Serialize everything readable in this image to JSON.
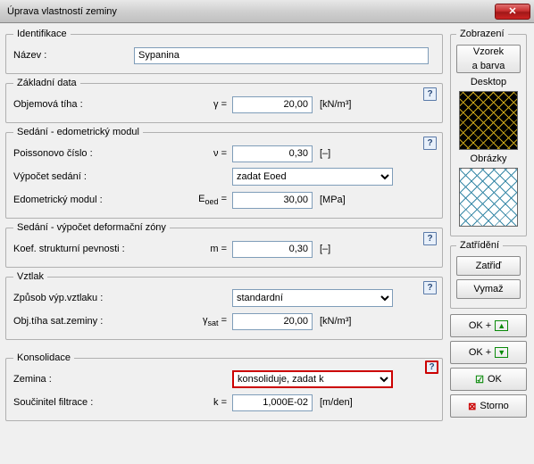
{
  "window": {
    "title": "Úprava vlastností zeminy"
  },
  "ident": {
    "legend": "Identifikace",
    "name_label": "Název :",
    "name_value": "Sypanina"
  },
  "basic": {
    "legend": "Základní data",
    "unit_weight_label": "Objemová tíha :",
    "gamma_sym": "γ =",
    "gamma_value": "20,00",
    "gamma_unit": "[kN/m³]"
  },
  "settlement": {
    "legend": "Sedání - edometrický modul",
    "poisson_label": "Poissonovo číslo :",
    "nu_sym": "ν =",
    "nu_value": "0,30",
    "nu_unit": "[–]",
    "calc_label": "Výpočet sedání :",
    "calc_selected": "zadat Eoed",
    "eoed_label": "Edometrický modul :",
    "eoed_sym": "Eₒₑd =",
    "eoed_value": "30,00",
    "eoed_unit": "[MPa]"
  },
  "defzone": {
    "legend": "Sedání - výpočet deformační zóny",
    "m_label": "Koef. strukturní pevnosti :",
    "m_sym": "m =",
    "m_value": "0,30",
    "m_unit": "[–]"
  },
  "uplift": {
    "legend": "Vztlak",
    "method_label": "Způsob výp.vztlaku :",
    "method_selected": "standardní",
    "gammasat_label": "Obj.tíha sat.zeminy :",
    "gammasat_sym": "γₛₐₜ =",
    "gammasat_value": "20,00",
    "gammasat_unit": "[kN/m³]"
  },
  "consol": {
    "legend": "Konsolidace",
    "soil_label": "Zemina :",
    "soil_selected": "konsoliduje, zadat k",
    "k_label": "Součinitel filtrace :",
    "k_sym": "k =",
    "k_value": "1,000E-02",
    "k_unit": "[m/den]"
  },
  "display": {
    "legend": "Zobrazení",
    "sample_btn_l1": "Vzorek",
    "sample_btn_l2": "a barva",
    "desktop_label": "Desktop",
    "images_label": "Obrázky"
  },
  "classify": {
    "legend": "Zatřídění",
    "classify_btn": "Zatřiď",
    "clear_btn": "Vymaž"
  },
  "buttons": {
    "ok_up": "OK +",
    "ok_down": "OK +",
    "ok": "OK",
    "cancel": "Storno"
  }
}
